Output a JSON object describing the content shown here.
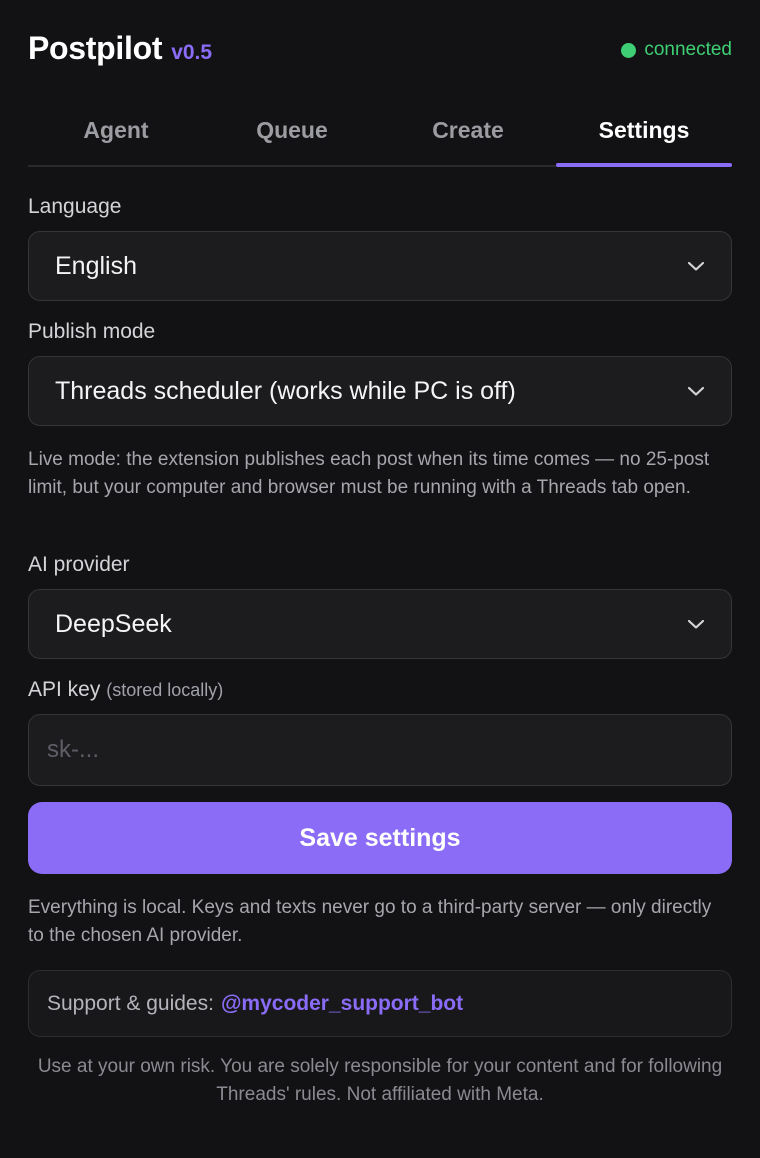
{
  "header": {
    "app_name": "Postpilot",
    "version": "v0.5",
    "status": "connected"
  },
  "tabs": [
    {
      "label": "Agent",
      "active": false
    },
    {
      "label": "Queue",
      "active": false
    },
    {
      "label": "Create",
      "active": false
    },
    {
      "label": "Settings",
      "active": true
    }
  ],
  "settings": {
    "language": {
      "label": "Language",
      "value": "English"
    },
    "publish_mode": {
      "label": "Publish mode",
      "value": "Threads scheduler (works while PC is off)",
      "help": "Live mode: the extension publishes each post when its time comes — no 25-post limit, but your computer and browser must be running with a Threads tab open."
    },
    "ai_provider": {
      "label": "AI provider",
      "value": "DeepSeek"
    },
    "api_key": {
      "label": "API key",
      "label_note": "(stored locally)",
      "value": "",
      "placeholder": "sk-..."
    },
    "save_label": "Save settings",
    "privacy_note": "Everything is local. Keys and texts never go to a third-party server — only directly to the chosen AI provider."
  },
  "support": {
    "prefix": "Support & guides:",
    "link": "@mycoder_support_bot"
  },
  "disclaimer": "Use at your own risk. You are solely responsible for your content and for following Threads' rules. Not affiliated with Meta.",
  "colors": {
    "accent": "#8b6cf6",
    "status_green": "#3ecf74",
    "background": "#121214"
  }
}
